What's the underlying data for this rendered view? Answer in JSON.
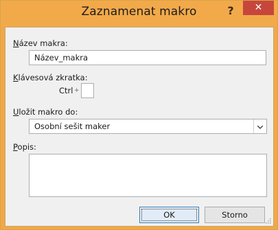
{
  "window": {
    "title": "Zaznamenat makro",
    "help_label": "?",
    "close_label": "✕"
  },
  "form": {
    "macro_name_label_prefix": "N",
    "macro_name_label_rest": "ázev makra:",
    "macro_name_value": "Název_makra",
    "shortcut_label_prefix": "K",
    "shortcut_label_rest": "lávesová zkratka:",
    "shortcut_ctrl": "Ctrl",
    "shortcut_plus": "+",
    "shortcut_value": "",
    "store_label_prefix": "U",
    "store_label_rest": "ložit makro do:",
    "store_selected": "Osobní sešit maker",
    "description_label_prefix": "P",
    "description_label_rest": "opis:",
    "description_value": ""
  },
  "buttons": {
    "ok": "OK",
    "cancel": "Storno"
  },
  "colors": {
    "titlebar": "#f2a94a",
    "close_button": "#c7463c",
    "client_bg": "#f0f0f0"
  }
}
